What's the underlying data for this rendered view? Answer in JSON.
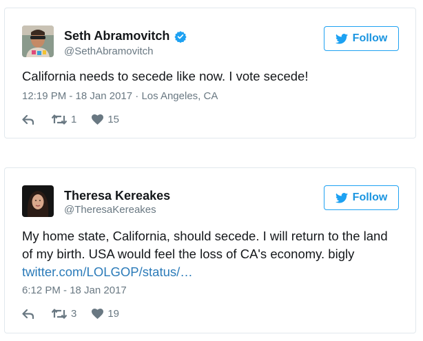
{
  "colors": {
    "brand_blue": "#1da1f2",
    "muted": "#697882",
    "link": "#2b7bb9"
  },
  "tweets": [
    {
      "name": "Seth Abramovitch",
      "handle": "@SethAbramovitch",
      "verified": true,
      "follow_label": "Follow",
      "text": "California needs to secede like now. I vote secede!",
      "link": "",
      "meta": "12:19 PM - 18 Jan 2017 · Los Angeles, CA",
      "retweets": "1",
      "likes": "15"
    },
    {
      "name": "Theresa Kereakes",
      "handle": "@TheresaKereakes",
      "verified": false,
      "follow_label": "Follow",
      "text": "My home state, California, should secede. I will return to the land of my birth. USA would feel the loss of CA's economy. bigly",
      "link": "twitter.com/LOLGOP/status/…",
      "meta": "6:12 PM - 18 Jan 2017",
      "retweets": "3",
      "likes": "19"
    }
  ]
}
